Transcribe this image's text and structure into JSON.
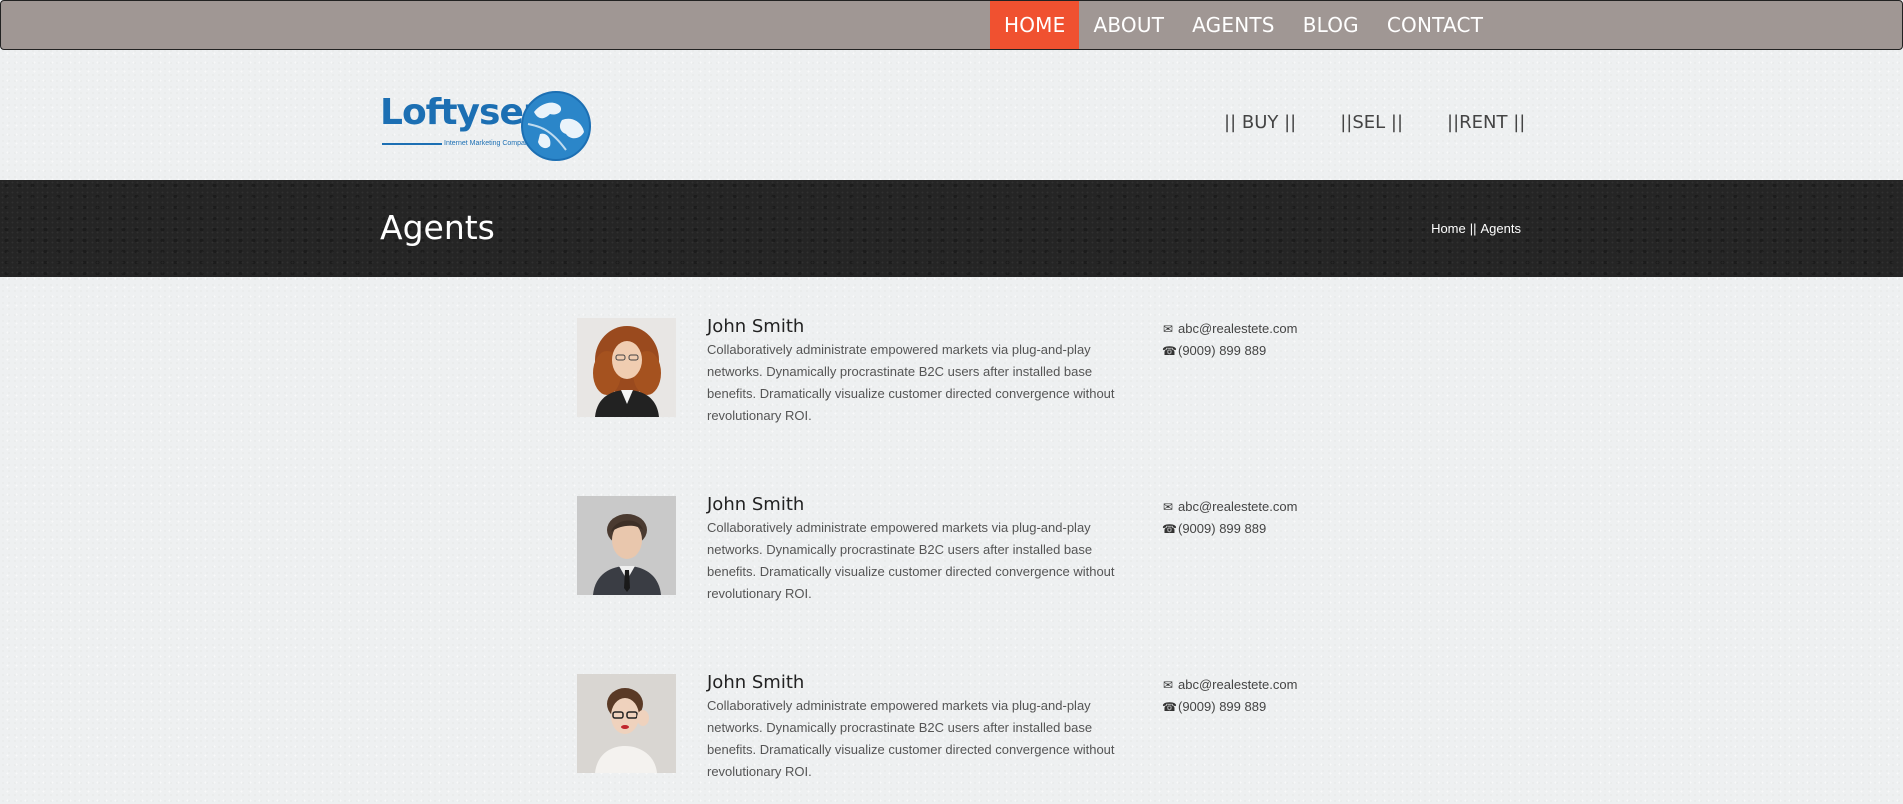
{
  "topnav": {
    "items": [
      {
        "label": "HOME",
        "active": true
      },
      {
        "label": "ABOUT",
        "active": false
      },
      {
        "label": "AGENTS",
        "active": false
      },
      {
        "label": "BLOG",
        "active": false
      },
      {
        "label": "CONTACT",
        "active": false
      }
    ],
    "accent_color": "#f05130",
    "bar_color": "#a09794"
  },
  "header": {
    "logo_text": "Loftyserp",
    "logo_tagline": "Internet Marketing Company",
    "subnav": [
      "|| BUY ||",
      "||SEL ||",
      "||RENT ||"
    ]
  },
  "titlebar": {
    "title": "Agents",
    "breadcrumb": {
      "home": "Home",
      "separator": "||",
      "current": "Agents"
    }
  },
  "agents": [
    {
      "name": "John Smith",
      "bio": "Collaboratively administrate empowered markets via plug-and-play networks. Dynamically procrastinate B2C users after installed base benefits. Dramatically visualize customer directed convergence without revolutionary ROI.",
      "email": "abc@realestete.com",
      "phone": "(9009) 899 889",
      "photo_icon": "agent-photo-woman-curly-hair"
    },
    {
      "name": "John Smith",
      "bio": "Collaboratively administrate empowered markets via plug-and-play networks. Dynamically procrastinate B2C users after installed base benefits. Dramatically visualize customer directed convergence without revolutionary ROI.",
      "email": "abc@realestete.com",
      "phone": "(9009) 899 889",
      "photo_icon": "agent-photo-man-suit"
    },
    {
      "name": "John Smith",
      "bio": "Collaboratively administrate empowered markets via plug-and-play networks. Dynamically procrastinate B2C users after installed base benefits. Dramatically visualize customer directed convergence without revolutionary ROI.",
      "email": "abc@realestete.com",
      "phone": "(9009) 899 889",
      "photo_icon": "agent-photo-woman-glasses"
    }
  ],
  "icons": {
    "email": "envelope-icon",
    "phone": "phone-icon"
  }
}
